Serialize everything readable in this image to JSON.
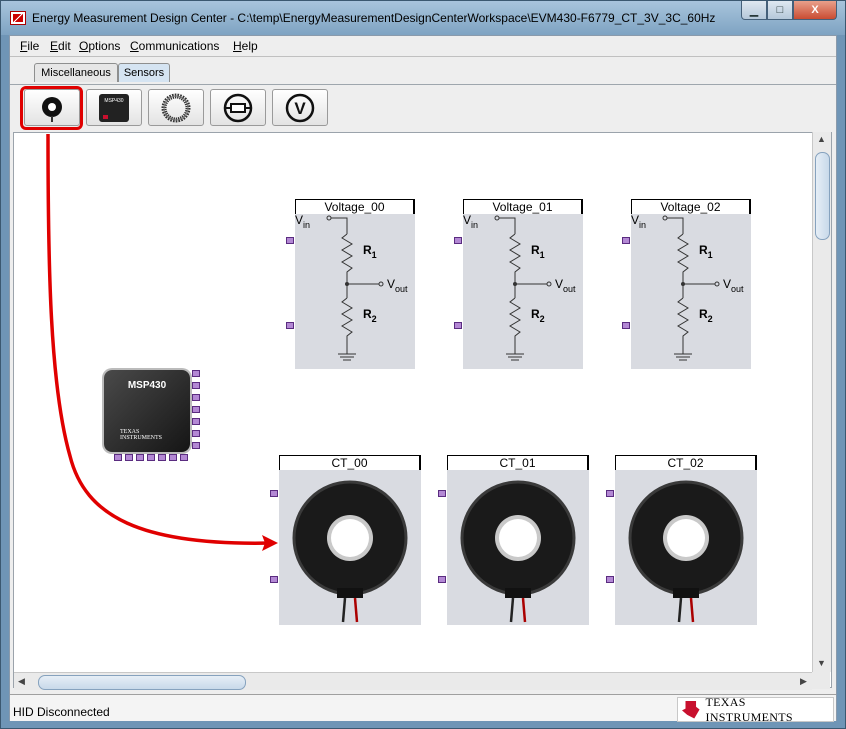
{
  "window": {
    "title": "Energy Measurement Design Center - C:\\temp\\EnergyMeasurementDesignCenterWorkspace\\EVM430-F6779_CT_3V_3C_60Hz",
    "minimize_glyph": "▁",
    "maximize_glyph": "□",
    "close_glyph": "X"
  },
  "menu": [
    {
      "hot": "F",
      "rest": "ile"
    },
    {
      "hot": "E",
      "rest": "dit"
    },
    {
      "hot": "O",
      "rest": "ptions"
    },
    {
      "hot": "C",
      "rest": "ommunications"
    },
    {
      "hot": "H",
      "rest": "elp"
    }
  ],
  "tabs": [
    "Miscellaneous",
    "Sensors"
  ],
  "active_tab": "Sensors",
  "toolbar": {
    "icons": [
      "current-transformer-icon",
      "msp430-chip-icon",
      "rogowski-coil-icon",
      "shunt-resistor-icon",
      "voltage-sensor-icon"
    ],
    "voltage_icon_letter": "V",
    "chip_icon_label": "MSP430",
    "selected_tool": "current-transformer-icon"
  },
  "canvas": {
    "voltage_blocks": [
      {
        "title": "Voltage_00"
      },
      {
        "title": "Voltage_01"
      },
      {
        "title": "Voltage_02"
      }
    ],
    "divider": {
      "vin": "V",
      "vin_sub": "in",
      "vout": "V",
      "vout_sub": "out",
      "r1": "R",
      "r1_sub": "1",
      "r2": "R",
      "r2_sub": "2"
    },
    "ct_blocks": [
      {
        "title": "CT_00"
      },
      {
        "title": "CT_01"
      },
      {
        "title": "CT_02"
      }
    ],
    "msp430": {
      "label": "MSP430",
      "brand_line1": "TEXAS",
      "brand_line2": "INSTRUMENTS"
    },
    "annotation_color": "#e00000"
  },
  "status": {
    "text": "HID Disconnected",
    "logo_text": "TEXAS INSTRUMENTS"
  },
  "colors": {
    "title_bar": "#8fb0cf",
    "block_bg": "#d9dbe1",
    "pin": "#b388d4",
    "ti_red": "#c8102e"
  }
}
